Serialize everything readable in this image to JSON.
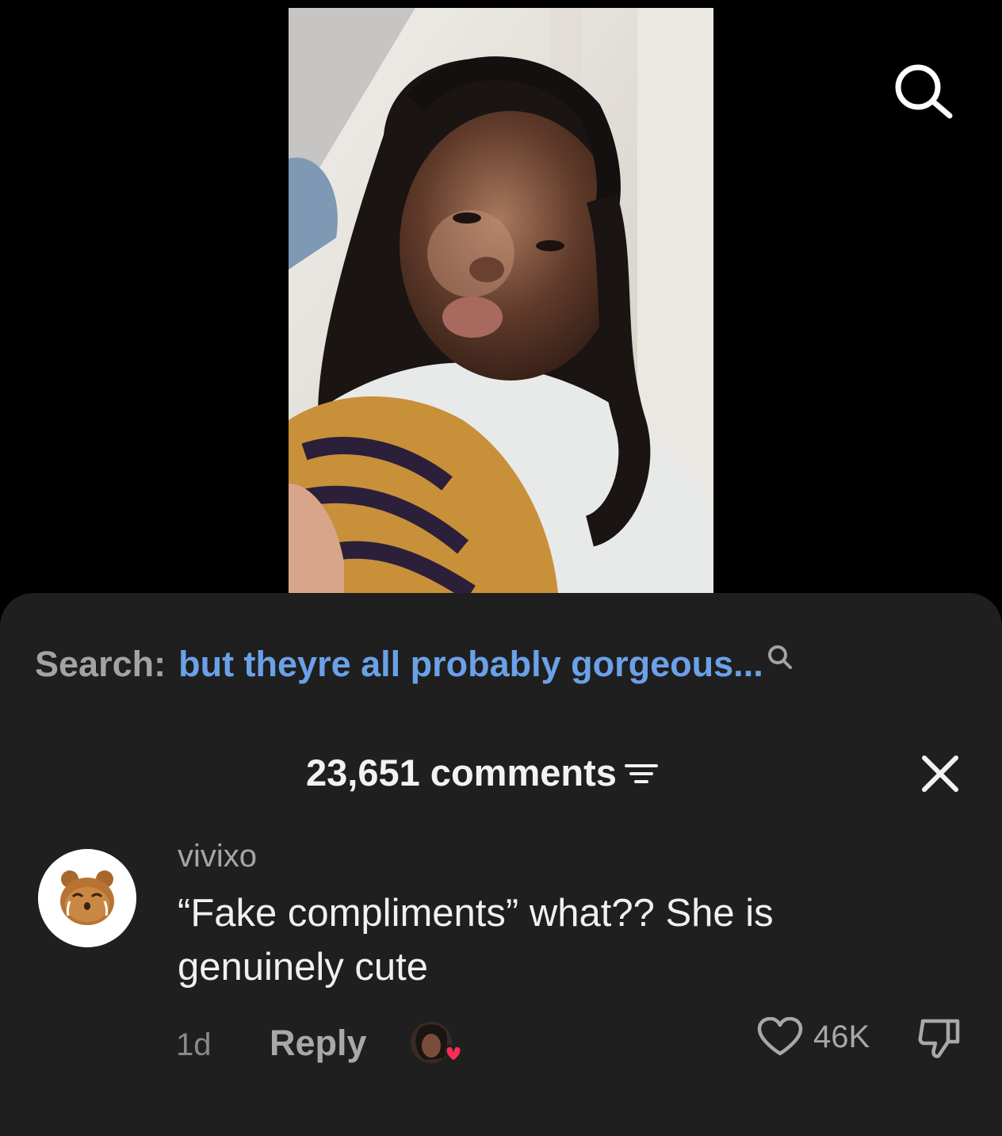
{
  "video": {
    "description_alt": "selfie video frame"
  },
  "top_bar": {
    "search_icon": "search-icon"
  },
  "comments_sheet": {
    "search_label": "Search:",
    "search_query": "but theyre all probably gorgeous...",
    "count_text": "23,651 comments",
    "filter_icon": "filter-icon",
    "close_icon": "close-icon"
  },
  "comment": {
    "username": "vivixo",
    "avatar_icon": "bear-avatar-icon",
    "text": "“Fake compliments” what?? She is genuinely cute",
    "timestamp": "1d",
    "reply_label": "Reply",
    "likes": "46K",
    "like_icon": "heart-outline-icon",
    "dislike_icon": "thumbs-down-icon",
    "creator_liked_icon": "creator-liked-heart-icon"
  },
  "colors": {
    "background": "#000000",
    "sheet": "#1f1f1f",
    "search_query": "#6aa1e8",
    "muted_text": "#a6a6a6",
    "primary_text": "#f0f0f0",
    "heart_badge": "#fe2c55"
  }
}
